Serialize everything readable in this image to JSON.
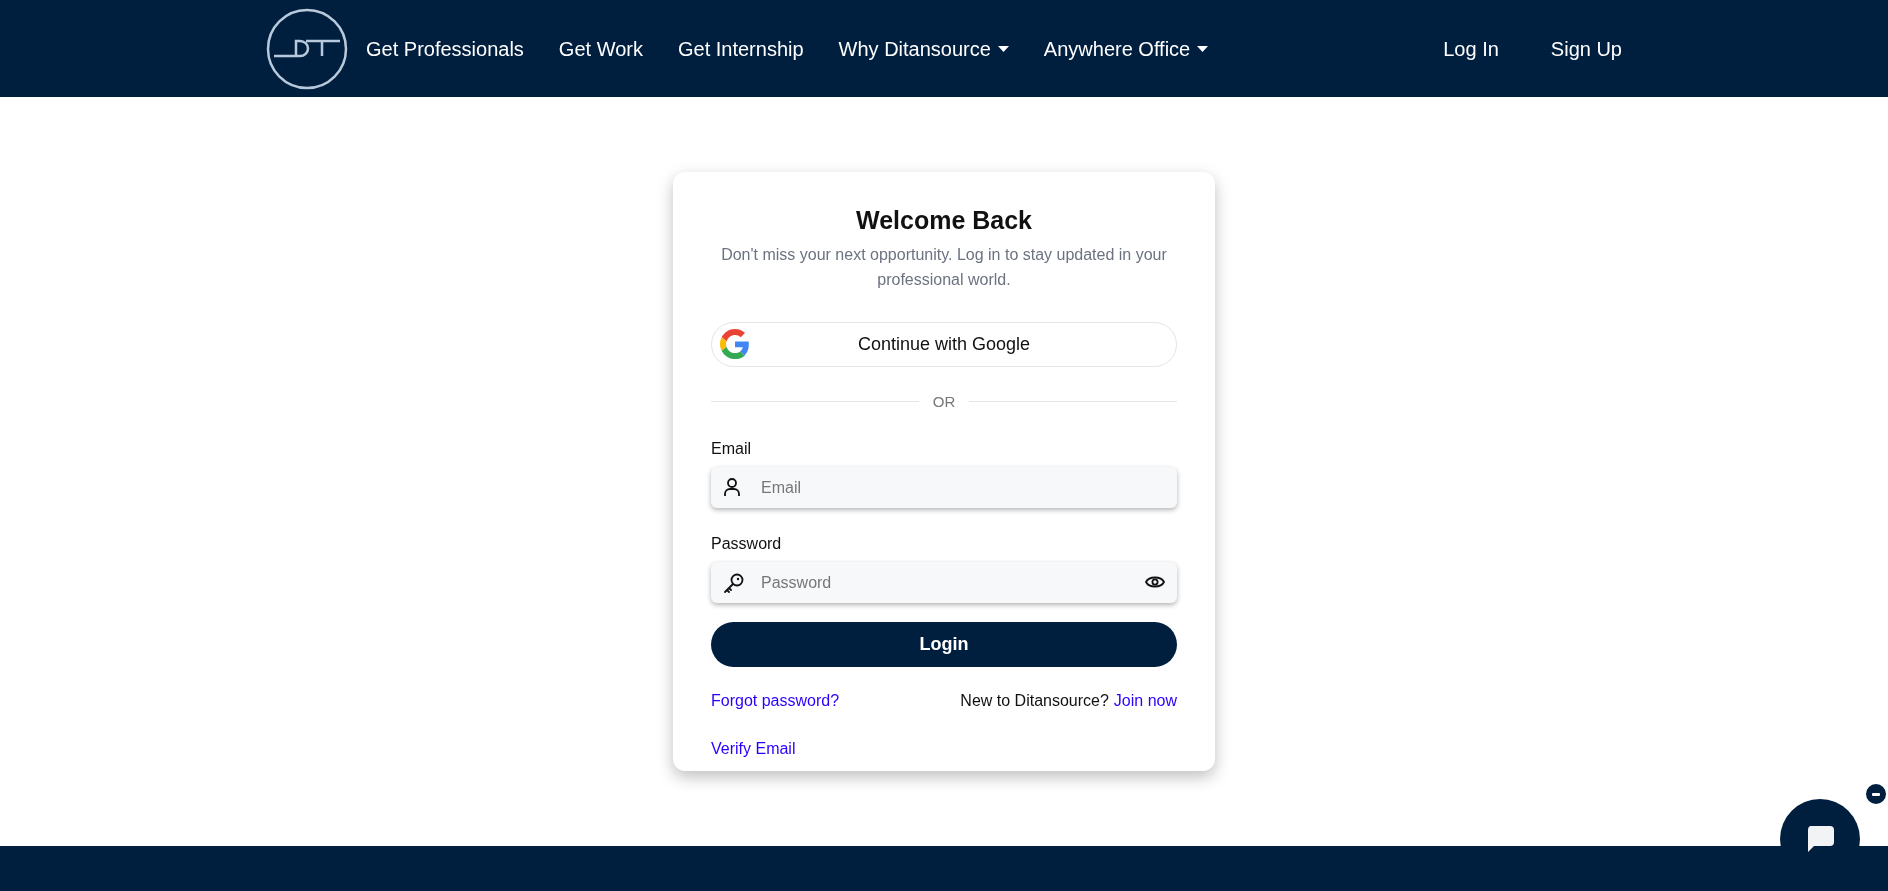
{
  "header": {
    "nav": [
      {
        "label": "Get Professionals",
        "kind": "link"
      },
      {
        "label": "Get Work",
        "kind": "link"
      },
      {
        "label": "Get Internship",
        "kind": "link"
      },
      {
        "label": "Why Ditansource",
        "kind": "dropdown"
      },
      {
        "label": "Anywhere Office",
        "kind": "dropdown"
      }
    ],
    "auth": [
      "Log In",
      "Sign Up"
    ]
  },
  "card": {
    "title": "Welcome Back",
    "subtitle": "Don't miss your next opportunity. Log in to stay updated in your professional world.",
    "google_button": "Continue with Google",
    "divider": "OR",
    "fields": [
      {
        "label": "Email",
        "placeholder": "Email",
        "kind": "user"
      },
      {
        "label": "Password",
        "placeholder": "Password",
        "kind": "password"
      }
    ],
    "login_button": "Login",
    "forgot_link": "Forgot password?",
    "join_prompt": "New to Ditansource?",
    "join_link": "Join now",
    "verify_link": "Verify Email"
  }
}
